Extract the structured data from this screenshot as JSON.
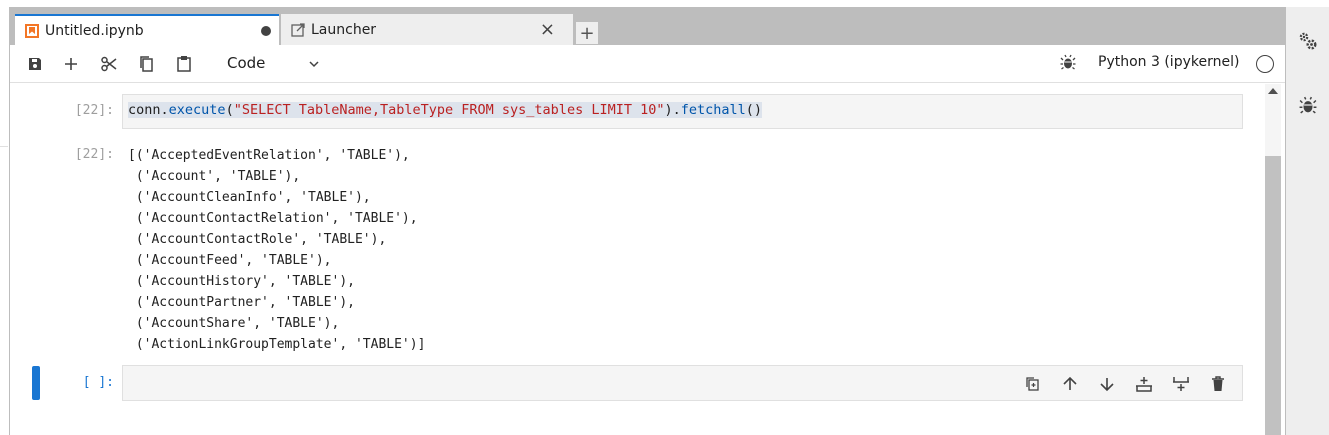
{
  "tabs": [
    {
      "label": "Untitled.ipynb",
      "icon": "notebook-icon",
      "active": true,
      "dirty": true
    },
    {
      "label": "Launcher",
      "icon": "launcher-icon",
      "active": false
    }
  ],
  "add_tab_label": "+",
  "toolbar": {
    "cell_type": "Code",
    "kernel_name": "Python 3 (ipykernel)"
  },
  "cells": [
    {
      "prompt": "[22]:",
      "input": {
        "obj": "conn",
        "dot1": ".",
        "method1": "execute",
        "open": "(",
        "string": "\"SELECT TableName,TableType FROM sys_tables LIMIT 10\"",
        "close": ")",
        "dot2": ".",
        "method2": "fetchall",
        "call": "()"
      },
      "output_prompt": "[22]:",
      "output": "[('AcceptedEventRelation', 'TABLE'),\n ('Account', 'TABLE'),\n ('AccountCleanInfo', 'TABLE'),\n ('AccountContactRelation', 'TABLE'),\n ('AccountContactRole', 'TABLE'),\n ('AccountFeed', 'TABLE'),\n ('AccountHistory', 'TABLE'),\n ('AccountPartner', 'TABLE'),\n ('AccountShare', 'TABLE'),\n ('ActionLinkGroupTemplate', 'TABLE')]"
    },
    {
      "prompt": "[ ]:",
      "input": ""
    }
  ],
  "colors": {
    "accent": "#1976d2",
    "string": "#ba2121",
    "attribute": "#0055aa",
    "prompt": "#9e9e9e",
    "tab_bar": "#bdbdbd"
  }
}
